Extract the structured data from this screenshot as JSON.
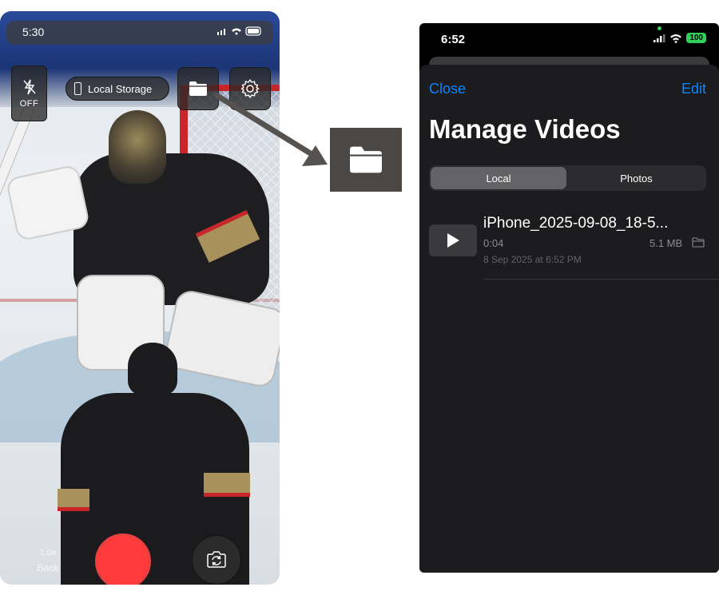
{
  "camera_screen": {
    "status_time": "5:30",
    "flash_label": "OFF",
    "storage_label": "Local Storage",
    "zoom_label": "1.0x",
    "back_label": "Back",
    "icons": {
      "flash": "flash-off-icon",
      "storage": "phone-storage-icon",
      "folder": "folder-icon",
      "settings": "gear-icon",
      "record": "record-icon",
      "flip": "camera-flip-icon"
    },
    "colors": {
      "record": "#ff3b3b"
    }
  },
  "callout": {
    "icon": "folder-icon"
  },
  "manage_videos": {
    "status_time": "6:52",
    "battery": "100",
    "nav": {
      "close_label": "Close",
      "edit_label": "Edit"
    },
    "title": "Manage Videos",
    "segments": [
      {
        "label": "Local",
        "selected": true
      },
      {
        "label": "Photos",
        "selected": false
      }
    ],
    "videos": [
      {
        "name": "iPhone_2025-09-08_18-5...",
        "duration": "0:04",
        "size": "5.1 MB",
        "date": "8 Sep 2025 at 6:52 PM"
      }
    ],
    "colors": {
      "accent": "#0a84ff",
      "battery": "#30d158",
      "sheet_bg": "#1c1c1e"
    }
  }
}
